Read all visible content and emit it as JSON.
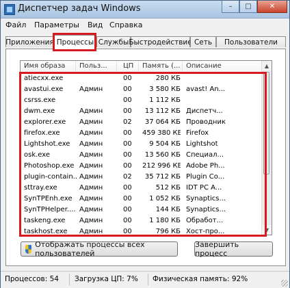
{
  "window": {
    "title": "Диспетчер задач Windows",
    "minimize_glyph": "–",
    "maximize_glyph": "□",
    "close_glyph": "✕"
  },
  "menu": [
    "Файл",
    "Параметры",
    "Вид",
    "Справка"
  ],
  "tabs": [
    "Приложения",
    "Процессы",
    "Службы",
    "Быстродействие",
    "Сеть",
    "Пользователи"
  ],
  "active_tab": "Процессы",
  "columns": [
    "Имя образа",
    "Польз...",
    "ЦП",
    "Память (...",
    "Описание"
  ],
  "rows": [
    {
      "name": "atiecxx.exe",
      "user": "",
      "cpu": "00",
      "mem": "280 КБ",
      "desc": ""
    },
    {
      "name": "avastui.exe",
      "user": "Админ",
      "cpu": "00",
      "mem": "3 580 КБ",
      "desc": "avast! An..."
    },
    {
      "name": "csrss.exe",
      "user": "",
      "cpu": "00",
      "mem": "1 112 КБ",
      "desc": ""
    },
    {
      "name": "dwm.exe",
      "user": "Админ",
      "cpu": "00",
      "mem": "13 112 КБ",
      "desc": "Диспетч..."
    },
    {
      "name": "explorer.exe",
      "user": "Админ",
      "cpu": "02",
      "mem": "37 064 КБ",
      "desc": "Проводник"
    },
    {
      "name": "firefox.exe",
      "user": "Админ",
      "cpu": "00",
      "mem": "459 380 КБ",
      "desc": "Firefox"
    },
    {
      "name": "Lightshot.exe",
      "user": "Админ",
      "cpu": "00",
      "mem": "9 504 КБ",
      "desc": "Lightshot"
    },
    {
      "name": "osk.exe",
      "user": "Админ",
      "cpu": "00",
      "mem": "13 560 КБ",
      "desc": "Специал..."
    },
    {
      "name": "Photoshop.exe",
      "user": "Админ",
      "cpu": "00",
      "mem": "212 996 КБ",
      "desc": "Adobe Ph..."
    },
    {
      "name": "plugin-contain...",
      "user": "Админ",
      "cpu": "02",
      "mem": "35 712 КБ",
      "desc": "Plugin Co..."
    },
    {
      "name": "sttray.exe",
      "user": "Админ",
      "cpu": "00",
      "mem": "512 КБ",
      "desc": "IDT PC A..."
    },
    {
      "name": "SynTPEnh.exe",
      "user": "Админ",
      "cpu": "00",
      "mem": "1 052 КБ",
      "desc": "Synaptics..."
    },
    {
      "name": "SynTPHelper....",
      "user": "Админ",
      "cpu": "00",
      "mem": "144 КБ",
      "desc": "Synaptics..."
    },
    {
      "name": "taskeng.exe",
      "user": "Админ",
      "cpu": "00",
      "mem": "1 180 КБ",
      "desc": "Обработ..."
    },
    {
      "name": "taskhost.exe",
      "user": "Админ",
      "cpu": "00",
      "mem": "796 КБ",
      "desc": "Хост-про..."
    }
  ],
  "buttons": {
    "show_all": "Отображать процессы всех пользователей",
    "end_process": "Завершить процесс"
  },
  "status": {
    "processes": "Процессов: 54",
    "cpu": "Загрузка ЦП: 7%",
    "memory": "Физическая память: 92%"
  },
  "colors": {
    "highlight": "#d71920",
    "window_bg": "#f0f0f0"
  }
}
